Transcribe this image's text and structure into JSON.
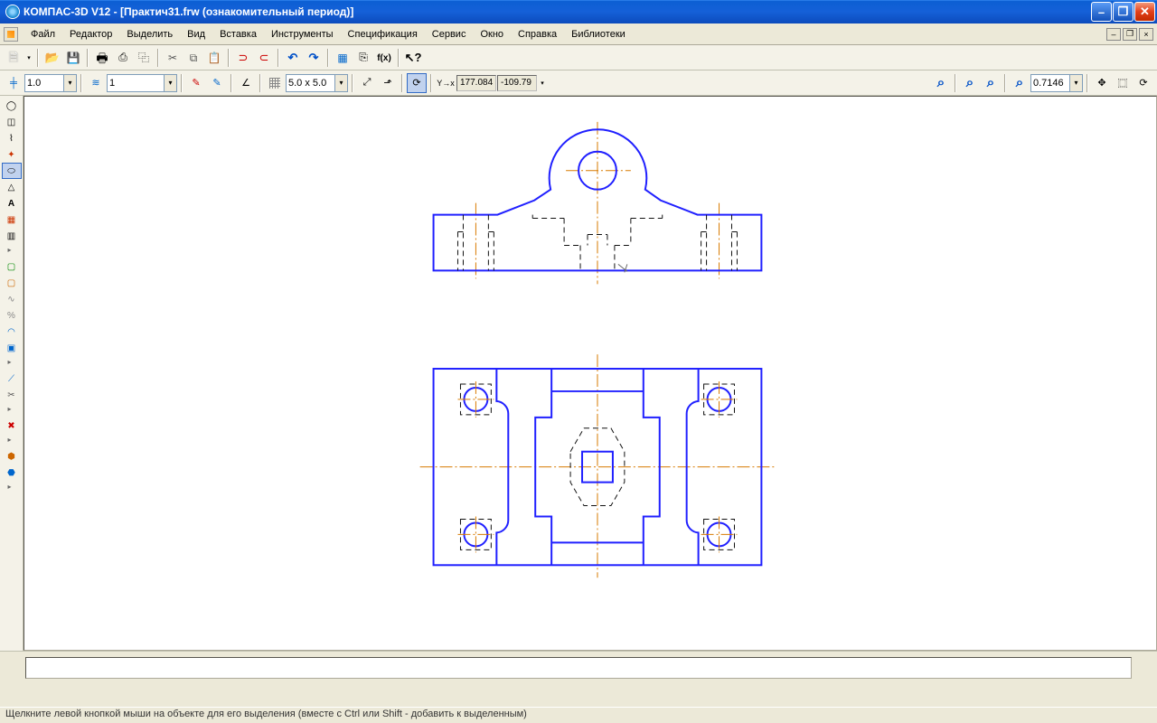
{
  "titlebar": {
    "text": "КОМПАС-3D V12 - [Практич31.frw (ознакомительный период)]"
  },
  "menu": {
    "items": [
      "Файл",
      "Редактор",
      "Выделить",
      "Вид",
      "Вставка",
      "Инструменты",
      "Спецификация",
      "Сервис",
      "Окно",
      "Справка",
      "Библиотеки"
    ]
  },
  "toolbar1": {
    "line_width": "1.0",
    "layer": "1",
    "grid_label": "5.0 x 5.0",
    "coord_x": "177.084",
    "coord_y": "-109.79",
    "zoom": "0.7146",
    "yx_label": "Y→x"
  },
  "statusbar": {
    "text": "Щелкните левой кнопкой мыши на объекте для его выделения (вместе с Ctrl или Shift - добавить к выделенным)"
  },
  "icons": {
    "file": "file",
    "open": "open",
    "save": "save",
    "print": "print",
    "cut": "cut",
    "copy": "copy",
    "paste": "paste",
    "undo": "undo",
    "redo": "redo"
  }
}
